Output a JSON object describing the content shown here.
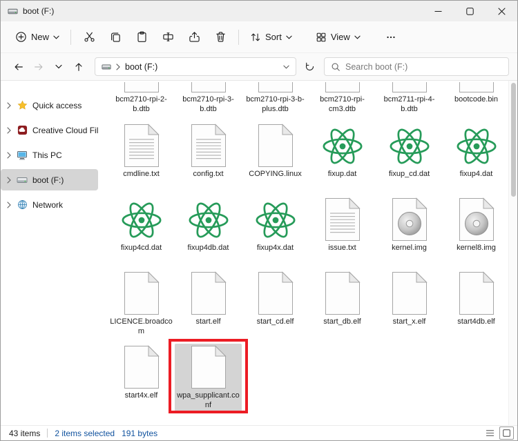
{
  "window": {
    "title": "boot (F:)"
  },
  "toolbar": {
    "new_label": "New",
    "sort_label": "Sort",
    "view_label": "View",
    "action_icons": [
      "cut-icon",
      "copy-icon",
      "paste-icon",
      "rename-icon",
      "share-icon",
      "delete-icon"
    ],
    "more_icon": "ellipsis-icon"
  },
  "address_bar": {
    "path": "boot (F:)",
    "path_icon": "drive-icon",
    "search_placeholder": "Search boot (F:)",
    "nav_icons": [
      "arrow-left-icon",
      "arrow-right-icon",
      "chevron-down-icon",
      "arrow-up-icon",
      "refresh-icon",
      "search-icon"
    ]
  },
  "sidebar": {
    "items": [
      {
        "label": "Quick access",
        "icon": "star-icon",
        "chevron": true,
        "selected": false
      },
      {
        "label": "Creative Cloud Files",
        "icon": "creative-cloud-icon",
        "chevron": true,
        "selected": false
      },
      {
        "label": "This PC",
        "icon": "computer-icon",
        "chevron": true,
        "selected": false
      },
      {
        "label": "boot (F:)",
        "icon": "usb-drive-icon",
        "chevron": true,
        "selected": true
      },
      {
        "label": "Network",
        "icon": "network-icon",
        "chevron": true,
        "selected": false
      }
    ]
  },
  "files": [
    {
      "name": "bcm2710-rpi-2-b.dtb",
      "icon": "file-icon",
      "cropped": true
    },
    {
      "name": "bcm2710-rpi-3-b.dtb",
      "icon": "file-icon",
      "cropped": true
    },
    {
      "name": "bcm2710-rpi-3-b-plus.dtb",
      "icon": "file-icon",
      "cropped": true
    },
    {
      "name": "bcm2710-rpi-cm3.dtb",
      "icon": "file-icon",
      "cropped": true
    },
    {
      "name": "bcm2711-rpi-4-b.dtb",
      "icon": "file-icon",
      "cropped": true
    },
    {
      "name": "bootcode.bin",
      "icon": "file-icon",
      "cropped": true
    },
    {
      "name": "cmdline.txt",
      "icon": "text-document-icon"
    },
    {
      "name": "config.txt",
      "icon": "text-document-icon"
    },
    {
      "name": "COPYING.linux",
      "icon": "file-icon"
    },
    {
      "name": "fixup.dat",
      "icon": "atom-icon"
    },
    {
      "name": "fixup_cd.dat",
      "icon": "atom-icon"
    },
    {
      "name": "fixup4.dat",
      "icon": "atom-icon"
    },
    {
      "name": "fixup4cd.dat",
      "icon": "atom-icon"
    },
    {
      "name": "fixup4db.dat",
      "icon": "atom-icon"
    },
    {
      "name": "fixup4x.dat",
      "icon": "atom-icon"
    },
    {
      "name": "issue.txt",
      "icon": "text-document-icon"
    },
    {
      "name": "kernel.img",
      "icon": "disc-image-icon"
    },
    {
      "name": "kernel8.img",
      "icon": "disc-image-icon"
    },
    {
      "name": "LICENCE.broadcom",
      "icon": "file-icon"
    },
    {
      "name": "start.elf",
      "icon": "file-icon"
    },
    {
      "name": "start_cd.elf",
      "icon": "file-icon"
    },
    {
      "name": "start_db.elf",
      "icon": "file-icon"
    },
    {
      "name": "start_x.elf",
      "icon": "file-icon"
    },
    {
      "name": "start4db.elf",
      "icon": "file-icon"
    },
    {
      "name": "start4x.elf",
      "icon": "file-icon"
    },
    {
      "name": "wpa_supplicant.conf",
      "icon": "file-icon",
      "selected": true,
      "annotated": true
    }
  ],
  "status_bar": {
    "items_count": "43 items",
    "selected_info": "2 items selected",
    "selected_size": "191 bytes"
  },
  "colors": {
    "annotation_red": "#ec1c24",
    "selection_gray": "#d4d4d4",
    "atom_green": "#269b59",
    "status_blue": "#10529e"
  }
}
